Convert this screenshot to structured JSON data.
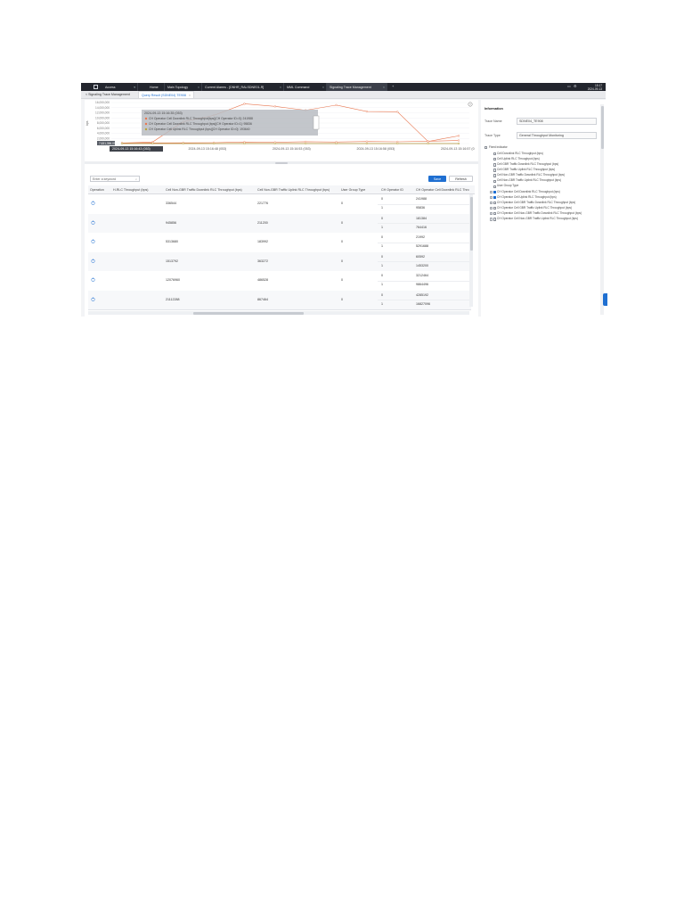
{
  "titlebar": {
    "tabs": [
      {
        "label": "Access"
      },
      {
        "label": "Home"
      },
      {
        "label": "Main Topology"
      },
      {
        "label": "Current Alarms - [DNHR_RALSDNE01-R]"
      },
      {
        "label": "MML Command"
      },
      {
        "label": "Signaling Trace Management"
      }
    ],
    "clock": {
      "time": "15:17",
      "date": "2024-09-13"
    },
    "close_glyph": "×",
    "add_glyph": "+",
    "colors": {
      "bar": "#23262e",
      "active_tab": "#3c404a"
    }
  },
  "subtabs": [
    {
      "label": "< Signaling Trace Management"
    },
    {
      "label": "Query Result (SDNE04)  TE908"
    }
  ],
  "chart_data": {
    "type": "line",
    "ylabel": "bps",
    "yticks": [
      "16,000,000",
      "14,000,000",
      "12,000,000",
      "10,000,000",
      "8,000,000",
      "6,000,000",
      "4,000,000",
      "2,000,000",
      "0"
    ],
    "ylim": [
      0,
      16000000
    ],
    "x_labels": [
      "2024-09-13 15:16:43 (053)",
      "2024-09-13 15:16:48 (053)",
      "2024-09-13 15:16:53 (053)",
      "2024-09-13 15:16:58 (053)",
      "2024-09-13 15:16:57 (0"
    ],
    "crosshair_label": "2024-09-13 15:16:43 (053)",
    "pin_label": "7,631,396.00",
    "tooltip": {
      "title": "2024-09-13 15:16:35 (053)",
      "lines": [
        "CH Operator Cell Downlink RLC Throughput(bps)[CH Operator ID=0]: 241988",
        "CH Operator Cell Downlink RLC Throughput (bps)[CH Operator ID=1]: 95836",
        "CH Operator Cell Uplink RLC Throughput (bps)[CH Operator ID=0]: 193640"
      ]
    },
    "series": [
      {
        "color": "#e8764f",
        "values": [
          200000,
          600000,
          8500000,
          11000000,
          15500000,
          14500000,
          13000000,
          15000000,
          12500000,
          12400000,
          800000,
          3000000
        ]
      },
      {
        "color": "#e8764f",
        "values": [
          150000,
          250000,
          300000,
          350000,
          600000,
          500000,
          700000,
          600000,
          800000,
          700000,
          900000,
          1200000
        ]
      },
      {
        "color": "#8e6b2e",
        "values": [
          0,
          0,
          0,
          0,
          0,
          0,
          0,
          0,
          0,
          0,
          0,
          0
        ]
      },
      {
        "color": "#b9a437",
        "values": [
          0,
          0,
          0,
          0,
          0,
          0,
          0,
          0,
          0,
          0,
          0,
          0
        ]
      }
    ],
    "grid": true
  },
  "table": {
    "search_placeholder": "Enter a keyword",
    "search_icon": "search-icon",
    "save_label": "Save",
    "refresh_label": "Refresh",
    "columns": [
      "Operation",
      "H-RLC Throughput (bps)",
      "Cell Non-GBR Traffic Downlink RLC Throughput (bps)",
      "Cell Non-GBR Traffic Uplink RLC Throughput (bps)",
      "User Group Type",
      "CH Operator ID",
      "CH Operator Cell Downlink RLC Thro"
    ],
    "rows": [
      {
        "dl": "336544",
        "ul": "221776",
        "group": "0",
        "ids": [
          "0",
          "1"
        ],
        "thr": [
          "241988",
          "95836"
        ]
      },
      {
        "dl": "945856",
        "ul": "211200",
        "group": "0",
        "ids": [
          "0",
          "1"
        ],
        "thr": [
          "181384",
          "764416"
        ]
      },
      {
        "dl": "5313680",
        "ul": "183992",
        "group": "0",
        "ids": [
          "0",
          "1"
        ],
        "thr": [
          "21992",
          "5291688"
        ]
      },
      {
        "dl": "1513792",
        "ul": "363272",
        "group": "0",
        "ids": [
          "0",
          "1"
        ],
        "thr": [
          "60592",
          "1453200"
        ]
      },
      {
        "dl": "12076960",
        "ul": "486528",
        "group": "0",
        "ids": [
          "0",
          "1"
        ],
        "thr": [
          "3212464",
          "9864496"
        ]
      },
      {
        "dl": "21112288",
        "ul": "867464",
        "group": "0",
        "ids": [
          "0",
          "1"
        ],
        "thr": [
          "4285192",
          "16827096"
        ]
      }
    ],
    "operation_icon": "chart-icon"
  },
  "info": {
    "title": "Information",
    "trace_name_label": "Trace Name",
    "trace_name_value": "SDNE04_TE908",
    "trace_type_label": "Trace Type",
    "trace_type_value": "General Throughput Monitoring",
    "fixed_label": "Fixed indicator",
    "options": [
      {
        "label": "Cell Downlink RLC Throughput (bps)",
        "checked": false
      },
      {
        "label": "Cell Uplink RLC Throughput (bps)",
        "checked": false
      },
      {
        "label": "Cell GBR Traffic Downlink RLC Throughput (bps)",
        "checked": false
      },
      {
        "label": "Cell GBR Traffic Uplink RLC Throughput (bps)",
        "checked": false
      },
      {
        "label": "Cell Non-GBR Traffic Downlink RLC Throughput (bps)",
        "checked": false
      },
      {
        "label": "Cell Non-GBR Traffic Uplink RLC Throughput (bps)",
        "checked": false
      },
      {
        "label": "User Group Type",
        "checked": false
      },
      {
        "label": "CH Operator Cell Downlink RLC Throughput (bps)",
        "checked": true
      },
      {
        "label": "CH Operator Cell Uplink RLC Throughput (bps)",
        "checked": true
      },
      {
        "label": "CH Operator Cell GBR Traffic Downlink RLC Throughput (bps)",
        "checked": false
      },
      {
        "label": "CH Operator Cell GBR Traffic Uplink RLC Throughput (bps)",
        "checked": false
      },
      {
        "label": "CH Operator Cell Non-GBR Traffic Downlink RLC Throughput (bps)",
        "checked": false
      },
      {
        "label": "CH Operator Cell Non-GBR Traffic Uplink RLC Throughput (bps)",
        "checked": false
      }
    ]
  }
}
